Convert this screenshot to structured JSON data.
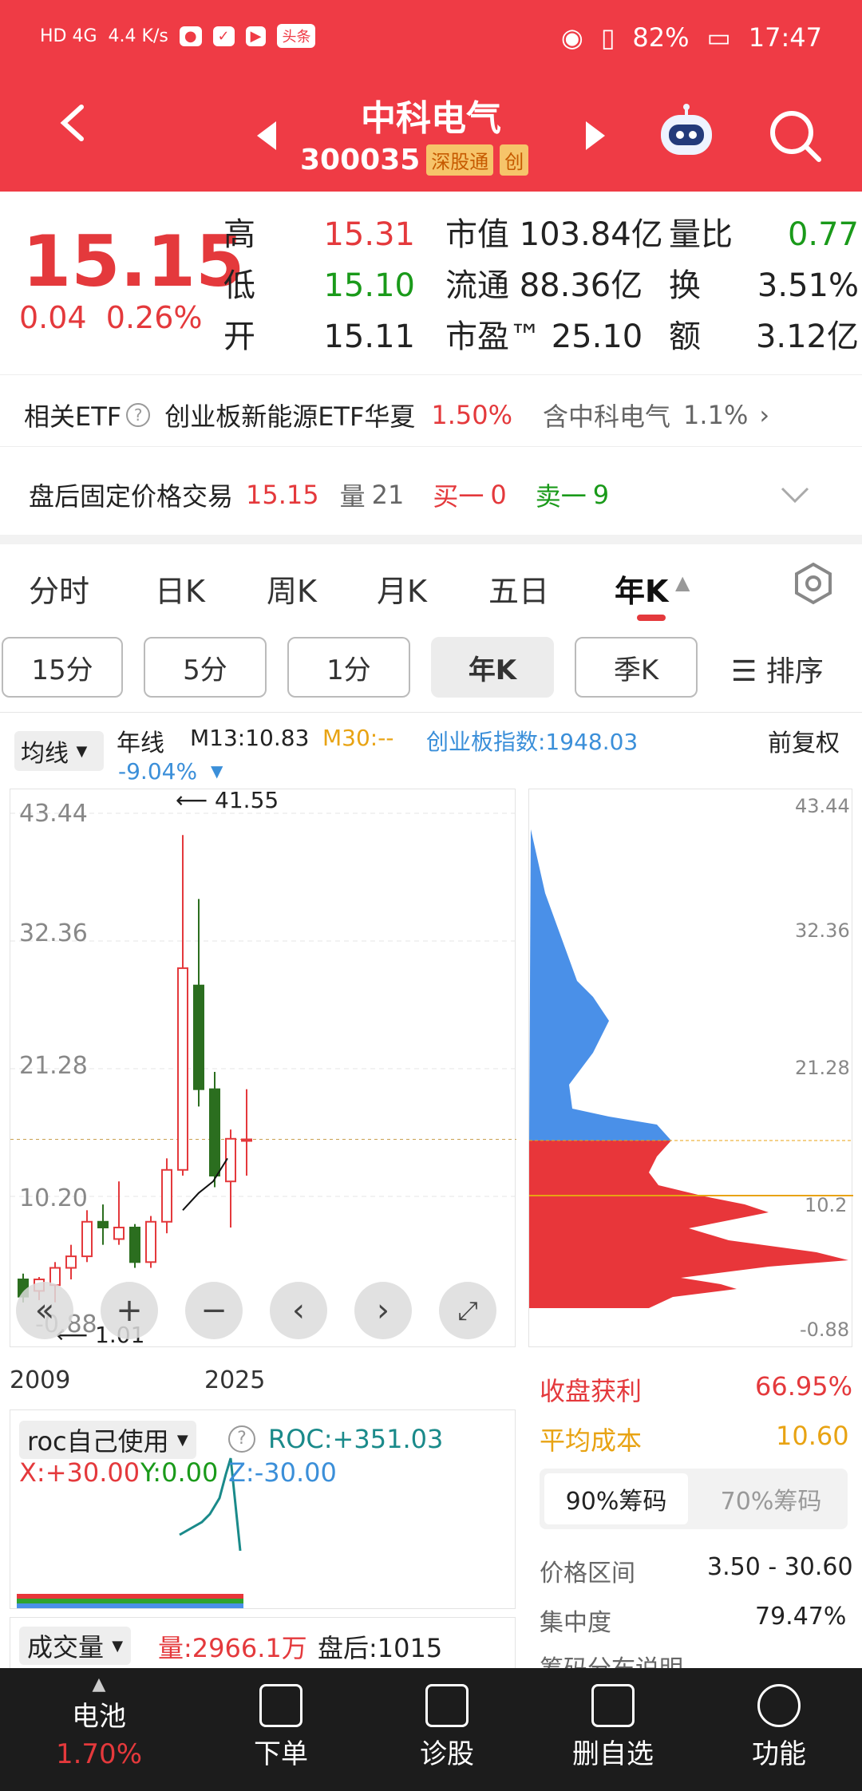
{
  "status_bar": {
    "network": "HD 4G",
    "speed": "4.4 K/s",
    "battery": "82%",
    "time": "17:47"
  },
  "header": {
    "title": "中科电气",
    "code": "300035",
    "tag1": "深股通",
    "tag2": "创"
  },
  "quote": {
    "price": "15.15",
    "change": "0.04",
    "change_pct": "0.26%",
    "col1": [
      {
        "k": "高",
        "v": "15.31"
      },
      {
        "k": "低",
        "v": "15.10"
      },
      {
        "k": "开",
        "v": "15.11"
      }
    ],
    "col2": [
      {
        "k": "市值",
        "v": "103.84亿"
      },
      {
        "k": "流通",
        "v": "88.36亿"
      },
      {
        "k": "市盈™",
        "v": "25.10"
      }
    ],
    "col3": [
      {
        "k": "量比",
        "v": "0.77"
      },
      {
        "k": "换",
        "v": "3.51%"
      },
      {
        "k": "额",
        "v": "3.12亿"
      }
    ]
  },
  "etf": {
    "label": "相关ETF",
    "name": "创业板新能源ETF华夏",
    "pct": "1.50%",
    "contains": "含中科电气",
    "weight": "1.1%"
  },
  "after_hours": {
    "label": "盘后固定价格交易",
    "price": "15.15",
    "vol_label": "量",
    "vol": "21",
    "buy_label": "买一",
    "buy": "0",
    "sell_label": "卖一",
    "sell": "9"
  },
  "period_tabs": [
    "分时",
    "日K",
    "周K",
    "月K",
    "五日",
    "年K"
  ],
  "interval_buttons": [
    "15分",
    "5分",
    "1分",
    "年K",
    "季K"
  ],
  "sort_label": "排序",
  "indicator": {
    "ma_selector": "均线",
    "period": "年线",
    "m13": "M13:10.83",
    "m30": "M30:--",
    "index": "创业板指数:1948.03",
    "index_chg": "-9.04%",
    "adjust": "前复权"
  },
  "kline": {
    "y_labels": [
      "43.44",
      "32.36",
      "21.28",
      "10.20",
      "-0.88"
    ],
    "high_marker": "41.55",
    "low_marker": "1.01",
    "x_start": "2009",
    "x_end": "2025"
  },
  "chip": {
    "y_labels": [
      "43.44",
      "32.36",
      "21.28",
      "10.2",
      "-0.88"
    ]
  },
  "roc": {
    "selector": "roc自己使用",
    "roc": "ROC:+351.03",
    "x": "X:+30.00",
    "y": "Y:0.00",
    "z": "Z:-30.00"
  },
  "volume": {
    "selector": "成交量",
    "vol": "量:2966.1万",
    "after": "盘后:1015"
  },
  "stats": {
    "profit_label": "收盘获利",
    "profit": "66.95%",
    "cost_label": "平均成本",
    "cost": "10.60",
    "tab90": "90%筹码",
    "tab70": "70%筹码",
    "range_label": "价格区间",
    "range": "3.50 - 30.60",
    "conc_label": "集中度",
    "conc": "79.47%",
    "note": "筹码分布说明"
  },
  "bottom_nav": [
    {
      "label": "电池",
      "sub": "1.70%"
    },
    {
      "label": "下单"
    },
    {
      "label": "诊股"
    },
    {
      "label": "删自选"
    },
    {
      "label": "功能"
    }
  ],
  "chart_data": {
    "type": "candlestick",
    "x_range": [
      "2009",
      "2025"
    ],
    "ylim": [
      -0.88,
      43.44
    ],
    "candles": [
      {
        "o": 3.0,
        "c": 1.5,
        "h": 3.5,
        "l": 1.0
      },
      {
        "o": 2.0,
        "c": 3.0,
        "h": 3.2,
        "l": 1.2
      },
      {
        "o": 2.5,
        "c": 4.0,
        "h": 4.5,
        "l": 1.01
      },
      {
        "o": 4.0,
        "c": 5.0,
        "h": 6.0,
        "l": 3.0
      },
      {
        "o": 5.0,
        "c": 8.0,
        "h": 9.0,
        "l": 4.5
      },
      {
        "o": 8.0,
        "c": 7.5,
        "h": 9.5,
        "l": 6.0
      },
      {
        "o": 6.5,
        "c": 7.5,
        "h": 11.5,
        "l": 6.0
      },
      {
        "o": 7.5,
        "c": 4.5,
        "h": 7.8,
        "l": 4.0
      },
      {
        "o": 4.5,
        "c": 8.0,
        "h": 8.5,
        "l": 4.0
      },
      {
        "o": 8.0,
        "c": 12.5,
        "h": 13.5,
        "l": 7.0
      },
      {
        "o": 12.5,
        "c": 30.0,
        "h": 41.55,
        "l": 12.0
      },
      {
        "o": 28.5,
        "c": 19.5,
        "h": 36.0,
        "l": 18.0
      },
      {
        "o": 19.5,
        "c": 12.0,
        "h": 21.0,
        "l": 11.0
      },
      {
        "o": 11.5,
        "c": 15.2,
        "h": 16.0,
        "l": 7.5
      },
      {
        "o": 15.1,
        "c": 15.15,
        "h": 19.5,
        "l": 12.0
      }
    ]
  }
}
